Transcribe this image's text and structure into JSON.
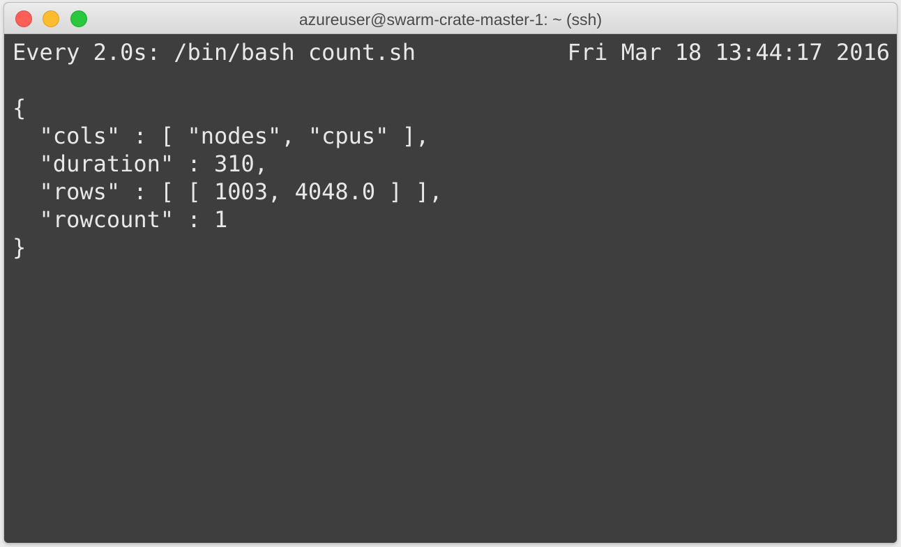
{
  "window": {
    "title": "azureuser@swarm-crate-master-1: ~ (ssh)"
  },
  "terminal": {
    "header_left": "Every 2.0s: /bin/bash count.sh",
    "header_right": "Fri Mar 18 13:44:17 2016",
    "output_lines": [
      "{",
      "  \"cols\" : [ \"nodes\", \"cpus\" ],",
      "  \"duration\" : 310,",
      "  \"rows\" : [ [ 1003, 4048.0 ] ],",
      "  \"rowcount\" : 1",
      "}"
    ]
  },
  "colors": {
    "terminal_background": "#3e3e3e",
    "terminal_text": "#e8e8e8",
    "close": "#fc5f57",
    "minimize": "#fdbc2e",
    "zoom": "#29c840"
  }
}
